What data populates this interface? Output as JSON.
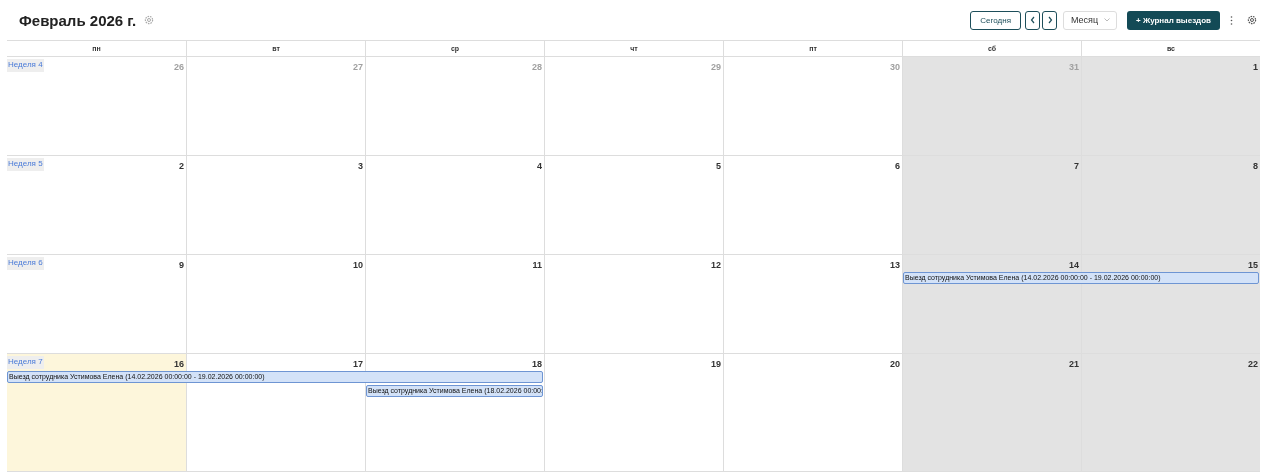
{
  "title": "Февраль 2026 г.",
  "toolbar": {
    "today": "Сегодня",
    "view": "Месяц",
    "add": "+ Журнал выездов"
  },
  "weekdays": [
    "пн",
    "вт",
    "ср",
    "чт",
    "пт",
    "сб",
    "вс"
  ],
  "weeks": [
    {
      "label": "Неделя 4",
      "days": [
        {
          "number": "26",
          "kind": "other",
          "weekend": false,
          "today": false
        },
        {
          "number": "27",
          "kind": "other",
          "weekend": false,
          "today": false
        },
        {
          "number": "28",
          "kind": "other",
          "weekend": false,
          "today": false
        },
        {
          "number": "29",
          "kind": "other",
          "weekend": false,
          "today": false
        },
        {
          "number": "30",
          "kind": "other",
          "weekend": false,
          "today": false
        },
        {
          "number": "31",
          "kind": "other",
          "weekend": true,
          "today": false
        },
        {
          "number": "1",
          "kind": "current",
          "weekend": true,
          "today": false
        }
      ]
    },
    {
      "label": "Неделя 5",
      "days": [
        {
          "number": "2",
          "kind": "current",
          "weekend": false,
          "today": false
        },
        {
          "number": "3",
          "kind": "current",
          "weekend": false,
          "today": false
        },
        {
          "number": "4",
          "kind": "current",
          "weekend": false,
          "today": false
        },
        {
          "number": "5",
          "kind": "current",
          "weekend": false,
          "today": false
        },
        {
          "number": "6",
          "kind": "current",
          "weekend": false,
          "today": false
        },
        {
          "number": "7",
          "kind": "current",
          "weekend": true,
          "today": false
        },
        {
          "number": "8",
          "kind": "current",
          "weekend": true,
          "today": false
        }
      ]
    },
    {
      "label": "Неделя 6",
      "days": [
        {
          "number": "9",
          "kind": "current",
          "weekend": false,
          "today": false
        },
        {
          "number": "10",
          "kind": "current",
          "weekend": false,
          "today": false
        },
        {
          "number": "11",
          "kind": "current",
          "weekend": false,
          "today": false
        },
        {
          "number": "12",
          "kind": "current",
          "weekend": false,
          "today": false
        },
        {
          "number": "13",
          "kind": "current",
          "weekend": false,
          "today": false
        },
        {
          "number": "14",
          "kind": "current",
          "weekend": true,
          "today": false,
          "lanes": [
            {
              "kind": "start",
              "text": "Выезд сотрудника Устимова Елена (14.02.2026 00:00:00 - 19.02.2026 00:00:00)"
            }
          ]
        },
        {
          "number": "15",
          "kind": "current",
          "weekend": true,
          "today": false,
          "lanes": [
            {
              "kind": "continue"
            }
          ]
        }
      ]
    },
    {
      "label": "Неделя 7",
      "days": [
        {
          "number": "16",
          "kind": "current",
          "weekend": false,
          "today": true,
          "lanes": [
            {
              "kind": "start",
              "text": "Выезд сотрудника Устимова Елена (14.02.2026 00:00:00 - 19.02.2026 00:00:00)"
            }
          ]
        },
        {
          "number": "17",
          "kind": "current",
          "weekend": false,
          "today": false,
          "lanes": [
            {
              "kind": "continue"
            }
          ]
        },
        {
          "number": "18",
          "kind": "current",
          "weekend": false,
          "today": false,
          "lanes": [
            {
              "kind": "continue"
            },
            {
              "kind": "start",
              "text": "Выезд сотрудника Устимова Елена (18.02.2026 00:00:"
            }
          ]
        },
        {
          "number": "19",
          "kind": "current",
          "weekend": false,
          "today": false
        },
        {
          "number": "20",
          "kind": "current",
          "weekend": false,
          "today": false
        },
        {
          "number": "21",
          "kind": "current",
          "weekend": true,
          "today": false
        },
        {
          "number": "22",
          "kind": "current",
          "weekend": true,
          "today": false
        }
      ]
    }
  ]
}
